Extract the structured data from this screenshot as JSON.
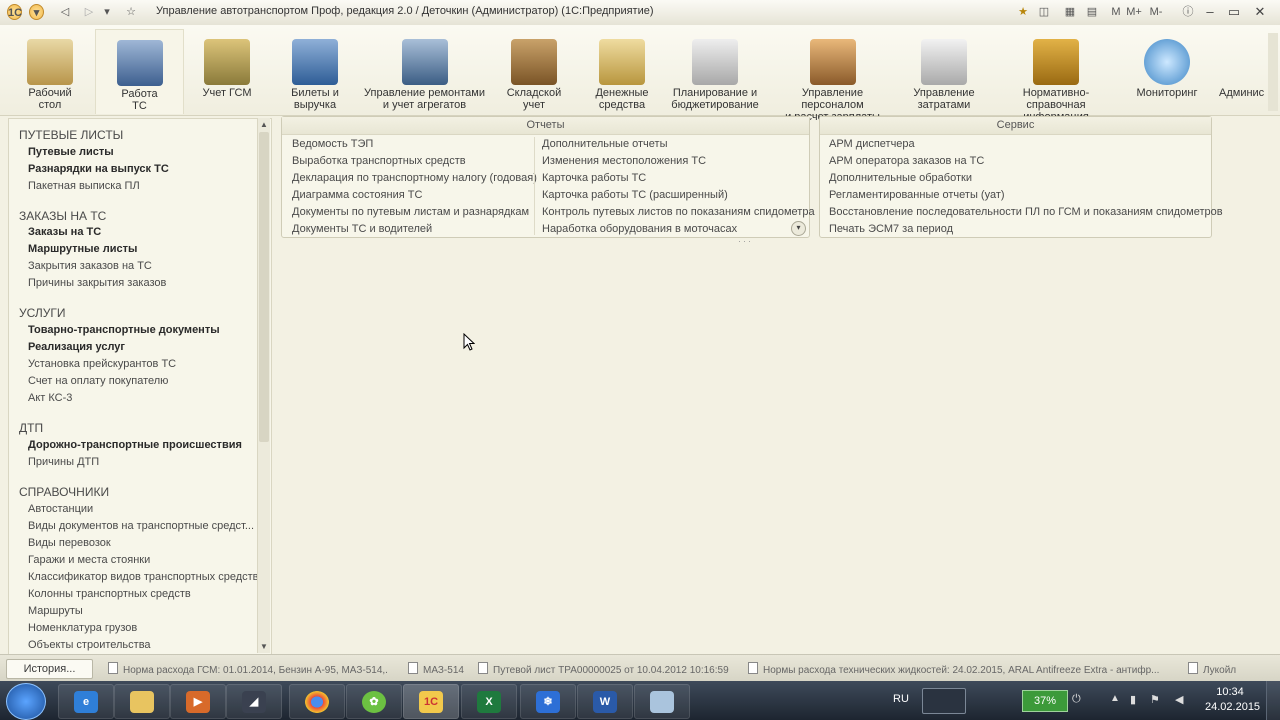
{
  "window": {
    "title": "Управление автотранспортом Проф, редакция 2.0 / Деточкин (Администратор)  (1С:Предприятие)",
    "logo": "1С"
  },
  "sections": [
    {
      "label": "Рабочий\nстол",
      "icon": "desk-icon"
    },
    {
      "label": "Работа\nТС",
      "icon": "truck-icon",
      "active": true
    },
    {
      "label": "Учет ГСМ",
      "icon": "fuel-icon"
    },
    {
      "label": "Билеты и\nвыручка",
      "icon": "tickets-icon"
    },
    {
      "label": "Управление ремонтами\nи учет агрегатов",
      "icon": "repair-truck-icon"
    },
    {
      "label": "Складской\nучет",
      "icon": "warehouse-icon"
    },
    {
      "label": "Денежные\nсредства",
      "icon": "money-icon"
    },
    {
      "label": "Планирование и\nбюджетирование",
      "icon": "planning-icon"
    },
    {
      "label": "Управление персоналом\nи расчет зарплаты",
      "icon": "personnel-icon"
    },
    {
      "label": "Управление\nзатратами",
      "icon": "costs-icon"
    },
    {
      "label": "Нормативно-справочная\nинформация",
      "icon": "reference-icon"
    },
    {
      "label": "Мониторинг",
      "icon": "monitoring-icon"
    },
    {
      "label": "Админис",
      "icon": "admin-icon"
    }
  ],
  "nav": {
    "groups": [
      {
        "title": "ПУТЕВЫЕ ЛИСТЫ",
        "items": [
          {
            "label": "Путевые листы",
            "bold": true
          },
          {
            "label": "Разнарядки на выпуск ТС",
            "bold": true
          },
          {
            "label": "Пакетная выписка ПЛ",
            "bold": false
          }
        ]
      },
      {
        "title": "ЗАКАЗЫ НА ТС",
        "items": [
          {
            "label": "Заказы на ТС",
            "bold": true
          },
          {
            "label": "Маршрутные листы",
            "bold": true
          },
          {
            "label": "Закрытия заказов на ТС",
            "bold": false
          },
          {
            "label": "Причины закрытия заказов",
            "bold": false
          }
        ]
      },
      {
        "title": "УСЛУГИ",
        "items": [
          {
            "label": "Товарно-транспортные документы",
            "bold": true
          },
          {
            "label": "Реализация услуг",
            "bold": true
          },
          {
            "label": "Установка прейскурантов ТС",
            "bold": false
          },
          {
            "label": "Счет на оплату покупателю",
            "bold": false
          },
          {
            "label": "Акт КС-3",
            "bold": false
          }
        ]
      },
      {
        "title": "ДТП",
        "items": [
          {
            "label": "Дорожно-транспортные происшествия",
            "bold": true
          },
          {
            "label": "Причины ДТП",
            "bold": false
          }
        ]
      },
      {
        "title": "СПРАВОЧНИКИ",
        "items": [
          {
            "label": "Автостанции",
            "bold": false
          },
          {
            "label": "Виды документов на транспортные средст...",
            "bold": false
          },
          {
            "label": "Виды перевозок",
            "bold": false
          },
          {
            "label": "Гаражи и места стоянки",
            "bold": false
          },
          {
            "label": "Классификатор видов транспортных средств",
            "bold": false
          },
          {
            "label": "Колонны транспортных средств",
            "bold": false
          },
          {
            "label": "Маршруты",
            "bold": false
          },
          {
            "label": "Номенклатура грузов",
            "bold": false
          },
          {
            "label": "Объекты строительства",
            "bold": false
          }
        ]
      }
    ]
  },
  "reports": {
    "title": "Отчеты",
    "col1": [
      "Ведомость ТЭП",
      "Выработка транспортных средств",
      "Декларация по транспортному налогу (годовая)",
      "Диаграмма состояния ТС",
      "Документы по путевым листам и разнарядкам",
      "Документы ТС и водителей"
    ],
    "col2": [
      "Дополнительные отчеты",
      "Изменения местоположения ТС",
      "Карточка работы ТС",
      "Карточка работы ТС (расширенный)",
      "Контроль путевых листов по показаниям спидометра",
      "Наработка оборудования в моточасах"
    ]
  },
  "service": {
    "title": "Сервис",
    "items": [
      "АРМ диспетчера",
      "АРМ оператора заказов на ТС",
      "Дополнительные обработки",
      "Регламентированные отчеты (уат)",
      "Восстановление последовательности ПЛ по ГСМ и показаниям спидометров",
      "Печать ЭСМ7 за период"
    ]
  },
  "history": {
    "button": "История...",
    "items": [
      "Норма расхода ГСМ: 01.01.2014, Бензин А-95, МАЗ-514,...",
      "МАЗ-514",
      "Путевой лист ТРА00000025 от 10.04.2012 10:16:59",
      "Нормы расхода технических жидкостей: 24.02.2015, ARAL Antifreeze Extra - антифр...",
      "Лукойл"
    ]
  },
  "taskbar": {
    "apps": [
      "ie-icon",
      "explorer-icon",
      "media-player-icon",
      "stealth-icon",
      "chrome-icon",
      "icq-icon",
      "1c-icon",
      "excel-icon",
      "snowflake-icon",
      "word-icon",
      "notes-icon"
    ],
    "language": "RU",
    "battery": "37%",
    "time": "10:34",
    "date": "24.02.2015"
  }
}
